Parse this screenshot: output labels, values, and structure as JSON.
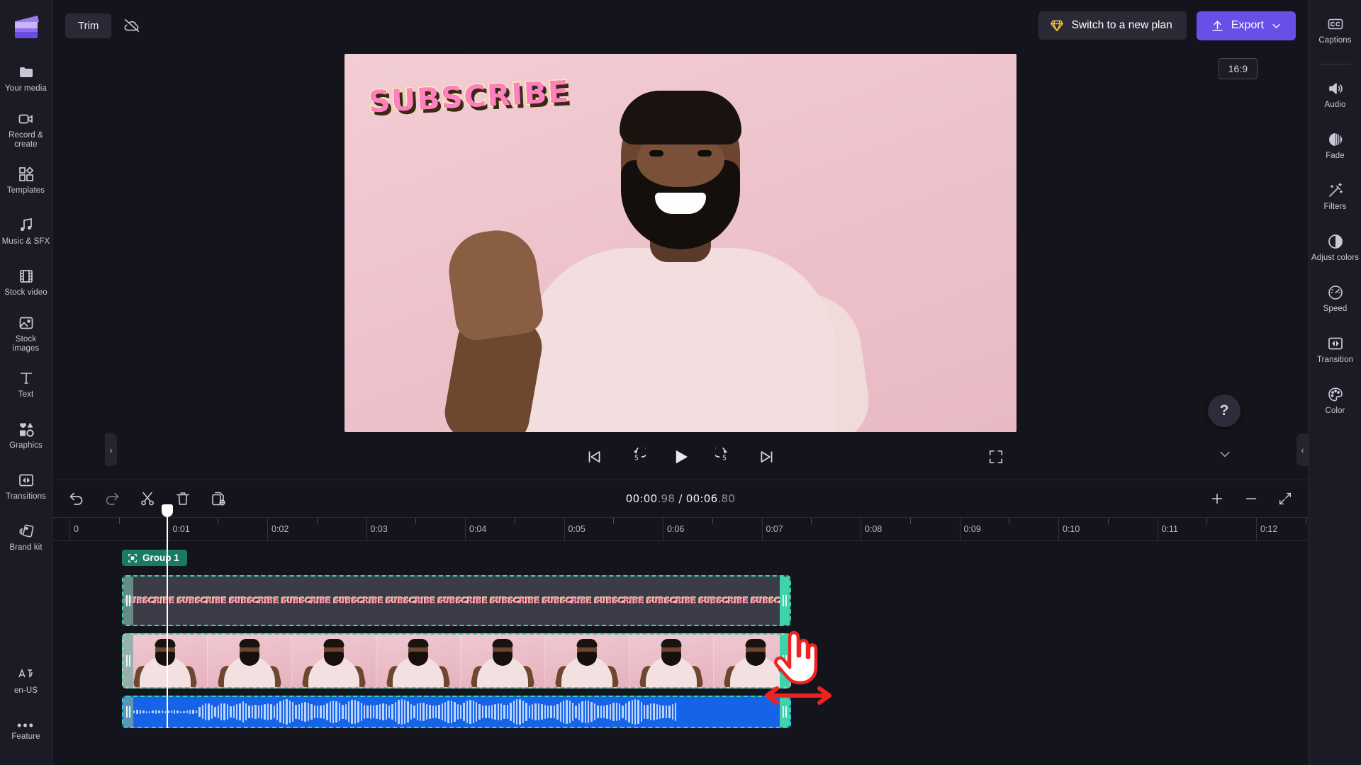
{
  "app": {
    "name": "Clipchamp",
    "logo_icon": "clapperboard-logo"
  },
  "left_sidebar": {
    "items": [
      {
        "icon": "folder-icon",
        "label": "Your media"
      },
      {
        "icon": "video-camera-icon",
        "label": "Record & create"
      },
      {
        "icon": "templates-grid-icon",
        "label": "Templates"
      },
      {
        "icon": "music-note-icon",
        "label": "Music & SFX"
      },
      {
        "icon": "film-strip-icon",
        "label": "Stock video"
      },
      {
        "icon": "image-icon",
        "label": "Stock images"
      },
      {
        "icon": "text-t-icon",
        "label": "Text"
      },
      {
        "icon": "shapes-icon",
        "label": "Graphics"
      },
      {
        "icon": "transitions-icon",
        "label": "Transitions"
      },
      {
        "icon": "brand-kit-icon",
        "label": "Brand kit"
      }
    ],
    "bottom_items": [
      {
        "icon": "language-icon",
        "label": "en-US"
      },
      {
        "icon": "more-dots-icon",
        "label": "Feature"
      }
    ]
  },
  "topbar": {
    "trim_label": "Trim",
    "cloud_icon": "cloud-off-icon",
    "plan_label": "Switch to a new plan",
    "plan_icon": "diamond-icon",
    "export_label": "Export",
    "export_icon": "upload-arrow-icon",
    "export_chevron": "chevron-down-icon",
    "export_color": "#6750e8"
  },
  "preview": {
    "aspect_ratio": "16:9",
    "sticker_text": "SUBSCRIBE",
    "sticker_color": "#ff7fc0",
    "background_color": "#eec3cc",
    "controls": [
      {
        "icon": "skip-to-start-icon",
        "label": "Skip to start"
      },
      {
        "icon": "rewind-5-icon",
        "label": "5"
      },
      {
        "icon": "play-icon",
        "label": "Play"
      },
      {
        "icon": "forward-5-icon",
        "label": "5"
      },
      {
        "icon": "skip-to-end-icon",
        "label": "Skip to end"
      }
    ],
    "fullscreen_icon": "fullscreen-icon",
    "help_label": "?",
    "chevron_down_icon": "chevron-down-icon",
    "collapse_left_icon": "chevron-right-icon",
    "collapse_right_icon": "chevron-left-icon"
  },
  "timeline": {
    "tools": [
      {
        "icon": "undo-icon",
        "label": "Undo"
      },
      {
        "icon": "redo-icon",
        "label": "Redo"
      },
      {
        "icon": "split-scissors-icon",
        "label": "Split"
      },
      {
        "icon": "delete-trash-icon",
        "label": "Delete"
      },
      {
        "icon": "duplicate-icon",
        "label": "Duplicate"
      }
    ],
    "current_time": "00:00",
    "current_time_frac": ".98",
    "separator": " / ",
    "total_time": "00:06",
    "total_time_frac": ".80",
    "zoom_controls": [
      {
        "icon": "zoom-in-plus-icon",
        "label": "Zoom in"
      },
      {
        "icon": "zoom-out-minus-icon",
        "label": "Zoom out"
      },
      {
        "icon": "fit-to-screen-icon",
        "label": "Fit to screen"
      }
    ],
    "ruler_labels": [
      "0",
      "0:01",
      "0:02",
      "0:03",
      "0:04",
      "0:05",
      "0:06",
      "0:07",
      "0:08",
      "0:09",
      "0:10",
      "0:11",
      "0:12"
    ],
    "group_label": "Group 1",
    "group_icon": "group-select-icon",
    "group_badge_color": "#1a7a63",
    "selection_color": "#35d6a8",
    "playhead_position_seconds": 0.98,
    "tracks": [
      {
        "name": "text-track",
        "type": "text",
        "clip_label": "SUBSCRIBE",
        "start": 0,
        "end": 6.8,
        "repeat_count": 13
      },
      {
        "name": "video-track",
        "type": "video",
        "start": 0,
        "end": 6.8,
        "thumbnail_count": 7
      },
      {
        "name": "audio-track",
        "type": "audio",
        "start": 0,
        "end": 6.8,
        "color": "#1763e8"
      }
    ]
  },
  "right_sidebar": {
    "top_item": {
      "icon": "captions-cc-icon",
      "label": "Captions"
    },
    "items": [
      {
        "icon": "audio-speaker-icon",
        "label": "Audio"
      },
      {
        "icon": "fade-icon",
        "label": "Fade"
      },
      {
        "icon": "filters-wand-icon",
        "label": "Filters"
      },
      {
        "icon": "adjust-colors-contrast-icon",
        "label": "Adjust colors"
      },
      {
        "icon": "speed-gauge-icon",
        "label": "Speed"
      },
      {
        "icon": "transition-icon",
        "label": "Transition"
      },
      {
        "icon": "color-palette-icon",
        "label": "Color"
      }
    ]
  },
  "annotations": {
    "cursor_icon": "pointing-hand-cursor",
    "drag_arrow_icon": "horizontal-double-arrow",
    "annotation_color": "#ef2222"
  }
}
